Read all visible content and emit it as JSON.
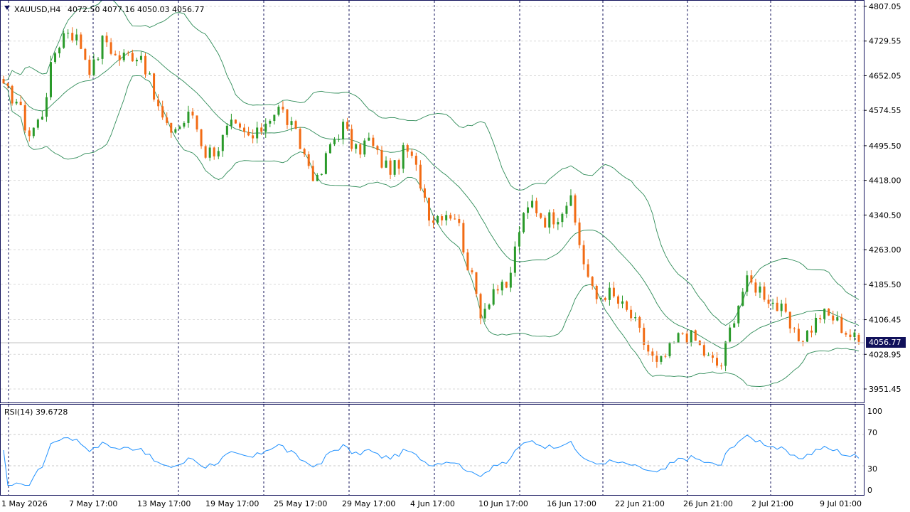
{
  "header": {
    "symbol_tf": "XAUUSD,H4",
    "ohlc": "4072.50 4077.16 4050.03 4056.77"
  },
  "current_price": "4056.77",
  "rsi": {
    "label": "RSI(14) 39.6728",
    "levels": [
      "100",
      "70",
      "30",
      "0"
    ]
  },
  "colors": {
    "bull": "#2a9a2a",
    "bear": "#f26b14",
    "band": "#2e8b57",
    "rsi_line": "#1e90ff",
    "grid": "#d9d9d9",
    "frame": "#10105a",
    "price_box": "#10105a"
  },
  "time_labels": [
    "1 May 2026",
    "7 May 17:00",
    "13 May 17:00",
    "19 May 17:00",
    "25 May 17:00",
    "29 May 17:00",
    "4 Jun 17:00",
    "10 Jun 17:00",
    "16 Jun 17:00",
    "22 Jun 21:00",
    "26 Jun 21:00",
    "2 Jul 21:00",
    "9 Jul 01:00"
  ],
  "chart_data": [
    {
      "type": "candlestick",
      "title": "XAUUSD,H4",
      "y_ticks": [
        "4807.05",
        "4729.55",
        "4652.05",
        "4574.55",
        "4495.50",
        "4418.00",
        "4340.50",
        "4263.00",
        "4185.50",
        "4106.45",
        "4028.95",
        "3951.45"
      ],
      "ylim": [
        3935,
        4810
      ],
      "x": [
        "1 May 2026",
        "7 May 17:00",
        "13 May 17:00",
        "19 May 17:00",
        "25 May 17:00",
        "29 May 17:00",
        "4 Jun 17:00",
        "10 Jun 17:00",
        "16 Jun 17:00",
        "22 Jun 21:00",
        "26 Jun 21:00",
        "2 Jul 21:00",
        "9 Jul 01:00"
      ],
      "close_path": [
        4620,
        4600,
        4520,
        4560,
        4700,
        4760,
        4730,
        4660,
        4740,
        4690,
        4700,
        4700,
        4600,
        4530,
        4540,
        4570,
        4480,
        4490,
        4540,
        4520,
        4510,
        4560,
        4580,
        4530,
        4470,
        4410,
        4500,
        4540,
        4480,
        4510,
        4460,
        4440,
        4490,
        4430,
        4330,
        4350,
        4340,
        4220,
        4120,
        4180,
        4170,
        4310,
        4370,
        4330,
        4340,
        4380,
        4250,
        4150,
        4170,
        4140,
        4110,
        4050,
        4000,
        4040,
        4080,
        4060,
        4020,
        4000,
        4110,
        4190,
        4180,
        4150,
        4120,
        4060,
        4080,
        4120,
        4110,
        4080,
        4056.77
      ],
      "series": [
        {
          "name": "Upper band"
        },
        {
          "name": "Middle band"
        },
        {
          "name": "Lower band"
        }
      ]
    },
    {
      "type": "line",
      "title": "RSI(14) 39.6728",
      "ylim": [
        0,
        100
      ],
      "y_ticks": [
        100,
        70,
        30,
        0
      ],
      "levels": [
        70,
        30
      ],
      "last_value": 39.6728
    }
  ]
}
